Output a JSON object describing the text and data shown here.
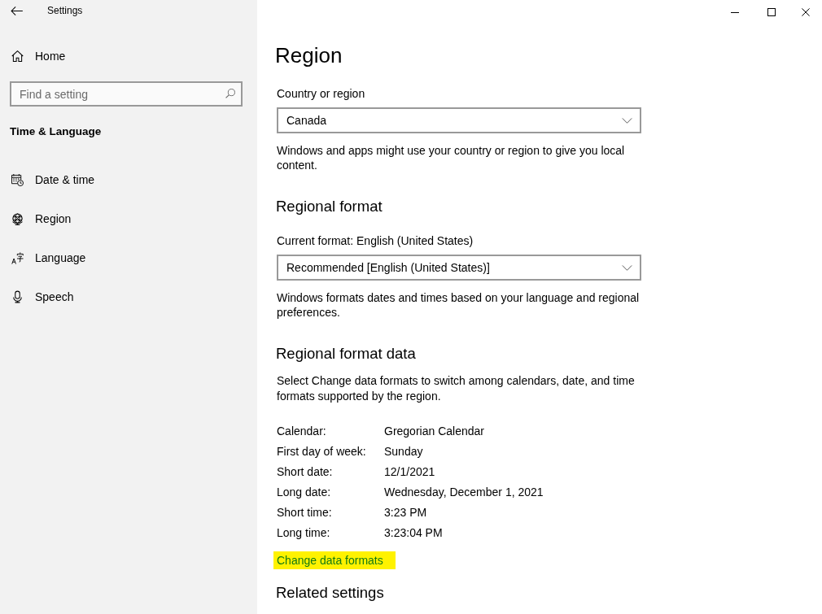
{
  "window": {
    "title": "Settings"
  },
  "sidebar": {
    "home": {
      "label": "Home"
    },
    "search": {
      "placeholder": "Find a setting"
    },
    "section_title": "Time & Language",
    "items": [
      {
        "kind": "datetime",
        "label": "Date & time",
        "selected": false
      },
      {
        "kind": "region",
        "label": "Region",
        "selected": false
      },
      {
        "kind": "language",
        "label": "Language",
        "selected": false
      },
      {
        "kind": "speech",
        "label": "Speech",
        "selected": false
      }
    ]
  },
  "content": {
    "title": "Region",
    "country": {
      "label": "Country or region",
      "value": "Canada",
      "description": "Windows and apps might use your country or region to give you local content."
    },
    "regional_format": {
      "heading": "Regional format",
      "label": "Current format: English (United States)",
      "value": "Recommended [English (United States)]",
      "description": "Windows formats dates and times based on your language and regional preferences."
    },
    "format_data": {
      "heading": "Regional format data",
      "description": "Select Change data formats to switch among calendars, date, and time formats supported by the region.",
      "rows": [
        {
          "label": "Calendar:",
          "value": "Gregorian Calendar"
        },
        {
          "label": "First day of week:",
          "value": "Sunday"
        },
        {
          "label": "Short date:",
          "value": "12/1/2021"
        },
        {
          "label": "Long date:",
          "value": "Wednesday, December 1, 2021"
        },
        {
          "label": "Short time:",
          "value": "3:23 PM"
        },
        {
          "label": "Long time:",
          "value": "3:23:04 PM"
        }
      ],
      "link": {
        "text": "Change data formats",
        "highlighted": true
      }
    },
    "related": {
      "heading": "Related settings"
    }
  }
}
